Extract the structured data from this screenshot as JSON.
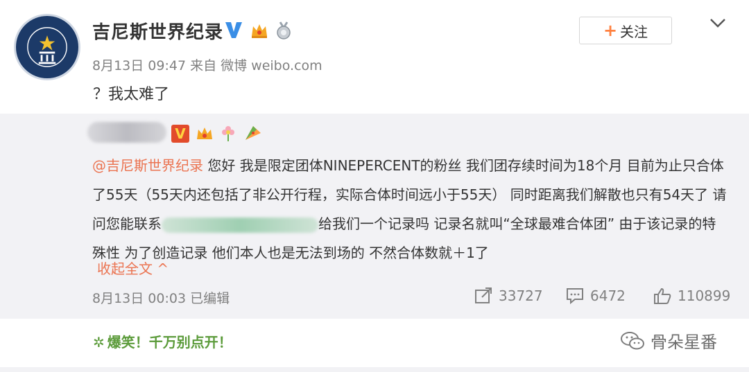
{
  "post": {
    "username": "吉尼斯世界纪录",
    "meta": "8月13日 09:47 来自 微博 weibo.com",
    "text": "？我太难了",
    "follow_label": "关注",
    "follow_plus": "+"
  },
  "repost": {
    "verified_label": "V",
    "mention": "@吉尼斯世界纪录",
    "text_part1": " 您好 我是限定团体NINEPERCENT的粉丝 我们团存续时间为18个月 目前为止只合体了55天（55天内还包括了非公开行程，实际合体时间远小于55天） 同时距离我们解散也只有54天了 请问您能联系",
    "text_part2": "给我们一个记录吗 记录名就叫“全球最难合体团” 由于该记录的特殊性 为了创造记录 他们本人也是无法到场的 不然合体数就＋1了",
    "collapse_label": "收起全文 ^",
    "meta": "8月13日 00:03  已编辑",
    "stats": {
      "reposts": "33727",
      "comments": "6472",
      "likes": "110899"
    }
  },
  "footer": {
    "promo": "爆笑！千万别点开！",
    "watermark": "骨朵星番"
  },
  "colors": {
    "accent_orange": "#eb7350",
    "follow_plus": "#ff8140",
    "promo_green": "#5b9b3a",
    "repost_bg": "#f2f2f5"
  },
  "icons": [
    "guinness-logo-avatar",
    "verified-v-icon",
    "crown-icon",
    "medal-icon",
    "chevron-down-icon",
    "flower-icon",
    "fan-icon",
    "repost-icon",
    "comment-icon",
    "like-icon",
    "sparkle-icon",
    "wechat-icon"
  ]
}
